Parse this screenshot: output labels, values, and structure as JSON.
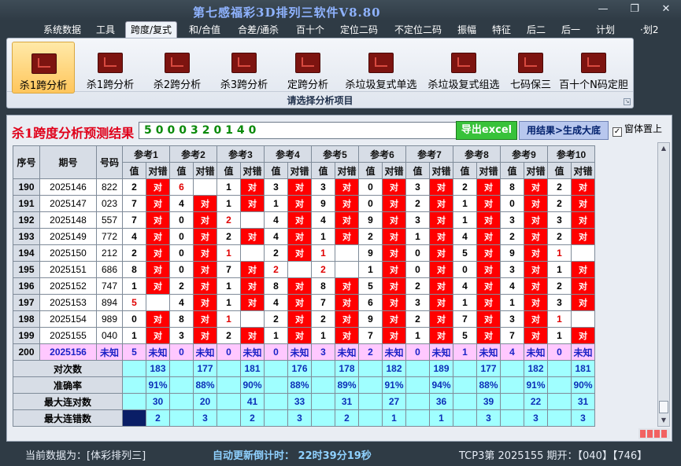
{
  "window": {
    "title": "第七感福彩3D排列三软件V8.80",
    "minimize_glyph": "—",
    "restore_glyph": "❐",
    "close_glyph": "✕"
  },
  "menu": {
    "items": [
      "系统数据",
      "工具",
      "跨度/复式",
      "和/合值",
      "合差/通杀",
      "百十个",
      "定位二码",
      "不定位二码",
      "振幅",
      "特征",
      "后二",
      "后一",
      "计划",
      "·划2"
    ],
    "active_index": 2
  },
  "ribbon": {
    "buttons": [
      "杀1跨分析",
      "杀1跨分析",
      "杀2跨分析",
      "杀3跨分析",
      "定跨分析",
      "杀垃圾复式单选",
      "杀垃圾复式组选",
      "七码保三",
      "百十个N码定胆"
    ],
    "selected_index": 0,
    "caption": "请选择分析项目",
    "launcher_glyph": "↘"
  },
  "result": {
    "title": "杀1跨度分析预测结果",
    "value": "5000320140",
    "export_label": "导出excel",
    "generate_label": "用结果>生成大底",
    "ontop_label": "窗体置上",
    "ontop_checked": "✓"
  },
  "table": {
    "headers": {
      "index": "序号",
      "period": "期号",
      "number": "号码",
      "value": "值",
      "check": "对错"
    },
    "refs": [
      "参考1",
      "参考2",
      "参考3",
      "参考4",
      "参考5",
      "参考6",
      "参考7",
      "参考8",
      "参考9",
      "参考10"
    ],
    "hit_text": "对",
    "rows": [
      {
        "idx": "190",
        "period": "2025146",
        "num": "822",
        "cells": [
          [
            "2",
            "hit"
          ],
          [
            "6",
            "miss"
          ],
          [
            "1",
            "hit"
          ],
          [
            "3",
            "hit"
          ],
          [
            "3",
            "hit"
          ],
          [
            "0",
            "hit"
          ],
          [
            "3",
            "hit"
          ],
          [
            "2",
            "hit"
          ],
          [
            "8",
            "hit"
          ],
          [
            "2",
            "hit"
          ]
        ],
        "red_cells": [
          1
        ]
      },
      {
        "idx": "191",
        "period": "2025147",
        "num": "023",
        "cells": [
          [
            "7",
            "hit"
          ],
          [
            "4",
            "hit"
          ],
          [
            "1",
            "hit"
          ],
          [
            "1",
            "hit"
          ],
          [
            "9",
            "hit"
          ],
          [
            "0",
            "hit"
          ],
          [
            "2",
            "hit"
          ],
          [
            "1",
            "hit"
          ],
          [
            "0",
            "hit"
          ],
          [
            "2",
            "hit"
          ]
        ],
        "red_cells": []
      },
      {
        "idx": "192",
        "period": "2025148",
        "num": "557",
        "cells": [
          [
            "7",
            "hit"
          ],
          [
            "0",
            "hit"
          ],
          [
            "2",
            "miss"
          ],
          [
            "4",
            "hit"
          ],
          [
            "4",
            "hit"
          ],
          [
            "9",
            "hit"
          ],
          [
            "3",
            "hit"
          ],
          [
            "1",
            "hit"
          ],
          [
            "3",
            "hit"
          ],
          [
            "3",
            "hit"
          ]
        ],
        "red_cells": [
          2
        ]
      },
      {
        "idx": "193",
        "period": "2025149",
        "num": "772",
        "cells": [
          [
            "4",
            "hit"
          ],
          [
            "0",
            "hit"
          ],
          [
            "2",
            "hit"
          ],
          [
            "4",
            "hit"
          ],
          [
            "1",
            "hit"
          ],
          [
            "2",
            "hit"
          ],
          [
            "1",
            "hit"
          ],
          [
            "4",
            "hit"
          ],
          [
            "2",
            "hit"
          ],
          [
            "2",
            "hit"
          ]
        ],
        "red_cells": []
      },
      {
        "idx": "194",
        "period": "2025150",
        "num": "212",
        "cells": [
          [
            "2",
            "hit"
          ],
          [
            "0",
            "hit"
          ],
          [
            "1",
            "miss"
          ],
          [
            "2",
            "hit"
          ],
          [
            "1",
            "miss"
          ],
          [
            "9",
            "hit"
          ],
          [
            "0",
            "hit"
          ],
          [
            "5",
            "hit"
          ],
          [
            "9",
            "hit"
          ],
          [
            "1",
            "miss"
          ]
        ],
        "red_cells": [
          2,
          4,
          9
        ]
      },
      {
        "idx": "195",
        "period": "2025151",
        "num": "686",
        "cells": [
          [
            "8",
            "hit"
          ],
          [
            "0",
            "hit"
          ],
          [
            "7",
            "hit"
          ],
          [
            "2",
            "miss"
          ],
          [
            "2",
            "miss"
          ],
          [
            "1",
            "hit"
          ],
          [
            "0",
            "hit"
          ],
          [
            "0",
            "hit"
          ],
          [
            "3",
            "hit"
          ],
          [
            "1",
            "hit"
          ]
        ],
        "red_cells": [
          3,
          4
        ]
      },
      {
        "idx": "196",
        "period": "2025152",
        "num": "747",
        "cells": [
          [
            "1",
            "hit"
          ],
          [
            "2",
            "hit"
          ],
          [
            "1",
            "hit"
          ],
          [
            "8",
            "hit"
          ],
          [
            "8",
            "hit"
          ],
          [
            "5",
            "hit"
          ],
          [
            "2",
            "hit"
          ],
          [
            "4",
            "hit"
          ],
          [
            "4",
            "hit"
          ],
          [
            "2",
            "hit"
          ]
        ],
        "red_cells": []
      },
      {
        "idx": "197",
        "period": "2025153",
        "num": "894",
        "cells": [
          [
            "5",
            "miss"
          ],
          [
            "4",
            "hit"
          ],
          [
            "1",
            "hit"
          ],
          [
            "4",
            "hit"
          ],
          [
            "7",
            "hit"
          ],
          [
            "6",
            "hit"
          ],
          [
            "3",
            "hit"
          ],
          [
            "1",
            "hit"
          ],
          [
            "1",
            "hit"
          ],
          [
            "3",
            "hit"
          ]
        ],
        "red_cells": [
          0
        ]
      },
      {
        "idx": "198",
        "period": "2025154",
        "num": "989",
        "cells": [
          [
            "0",
            "hit"
          ],
          [
            "8",
            "hit"
          ],
          [
            "1",
            "miss"
          ],
          [
            "2",
            "hit"
          ],
          [
            "2",
            "hit"
          ],
          [
            "9",
            "hit"
          ],
          [
            "2",
            "hit"
          ],
          [
            "7",
            "hit"
          ],
          [
            "3",
            "hit"
          ],
          [
            "1",
            "miss"
          ]
        ],
        "red_cells": [
          2,
          9
        ]
      },
      {
        "idx": "199",
        "period": "2025155",
        "num": "040",
        "cells": [
          [
            "1",
            "hit"
          ],
          [
            "3",
            "hit"
          ],
          [
            "2",
            "hit"
          ],
          [
            "1",
            "hit"
          ],
          [
            "1",
            "hit"
          ],
          [
            "7",
            "hit"
          ],
          [
            "1",
            "hit"
          ],
          [
            "5",
            "hit"
          ],
          [
            "7",
            "hit"
          ],
          [
            "1",
            "hit"
          ]
        ],
        "red_cells": []
      }
    ],
    "unknown_row": {
      "idx": "200",
      "period": "2025156",
      "num": "未知",
      "values": [
        "5",
        "0",
        "0",
        "0",
        "3",
        "2",
        "0",
        "1",
        "4",
        "0"
      ],
      "mark": "未知"
    },
    "stats": [
      {
        "label": "对次数",
        "values": [
          "183",
          "177",
          "181",
          "176",
          "178",
          "182",
          "189",
          "177",
          "182",
          "181"
        ]
      },
      {
        "label": "准确率",
        "values": [
          "91%",
          "88%",
          "90%",
          "88%",
          "89%",
          "91%",
          "94%",
          "88%",
          "91%",
          "90%"
        ]
      },
      {
        "label": "最大连对数",
        "values": [
          "30",
          "20",
          "41",
          "33",
          "31",
          "27",
          "36",
          "39",
          "22",
          "31"
        ]
      },
      {
        "label": "最大连错数",
        "values": [
          "2",
          "3",
          "2",
          "3",
          "2",
          "1",
          "1",
          "3",
          "3",
          "3"
        ]
      }
    ]
  },
  "scrollbar": {
    "up_glyph": "▲",
    "down_glyph": "▼"
  },
  "status": {
    "data_source": "当前数据为：[体彩排列三]",
    "countdown": "自动更新倒计时： 22时39分19秒",
    "issue": "TCP3第 2025155 期开：【040】【746】"
  },
  "colors": {
    "hit": "#ff0000",
    "unknown_row": "#ffc8ff",
    "stats_row": "#a0ffff",
    "title_red": "#e0001a",
    "result_green": "#0a8a0a"
  }
}
